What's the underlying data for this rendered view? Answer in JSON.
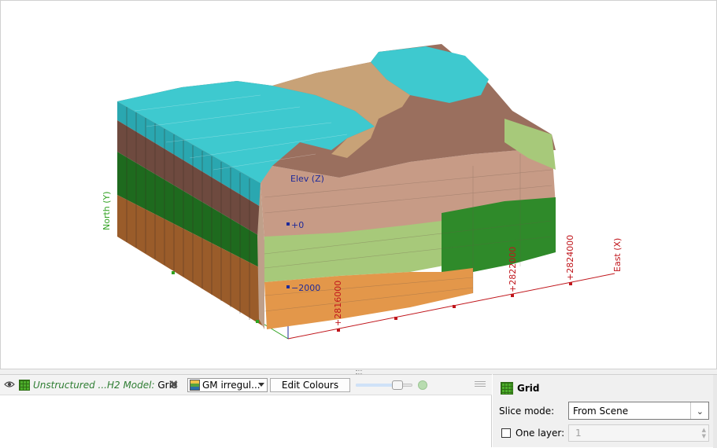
{
  "viewport": {
    "axes": {
      "elevation_label": "Elev (Z)",
      "north_label": "North (Y)",
      "east_label": "East (X)",
      "z_ticks": [
        "+0",
        "−2000"
      ],
      "x_ticks": [
        "+2816000",
        "+2822000",
        "+2824000"
      ]
    }
  },
  "layer_toolbar": {
    "layer_name_italic": "Unstructured ...H2 Model:",
    "layer_name_plain": " Grid",
    "colour_select_value": "GM irregul...",
    "edit_colours_label": "Edit Colours",
    "opacity_percent": 80
  },
  "properties": {
    "title": "Grid",
    "slice_mode_label": "Slice mode:",
    "slice_mode_value": "From Scene",
    "one_layer_label": "One layer:",
    "one_layer_value": "1",
    "one_layer_checked": false
  },
  "colors": {
    "cyan": "#3ec9cf",
    "brown": "#9a6f5e",
    "tan": "#c8a277",
    "light_green": "#a7c97a",
    "dark_green": "#2f8a2a",
    "orange": "#e3974a",
    "axis_red": "#c0161c",
    "axis_blue": "#1e2a9a",
    "axis_green": "#2fa11f"
  }
}
